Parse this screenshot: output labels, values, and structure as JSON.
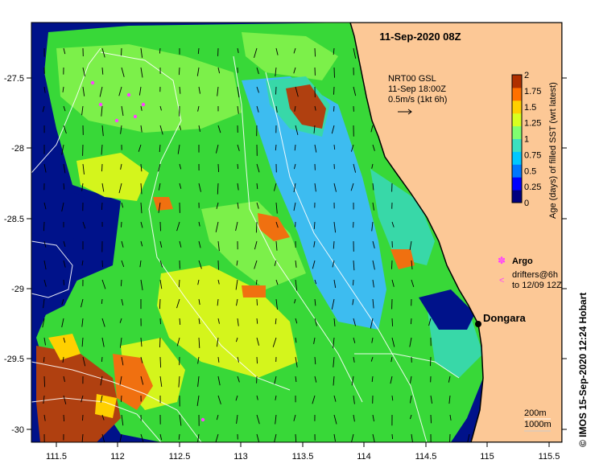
{
  "title": "11-Sep-2020 08Z",
  "product": {
    "line1": "NRT00 GSL",
    "line2": "11-Sep 18:00Z",
    "line3": "0.5m/s (1kt 6h)"
  },
  "colorbar": {
    "label": "Age (days) of filled SST (wrt latest)",
    "ticks": [
      "0",
      "0.25",
      "0.5",
      "0.75",
      "1",
      "1.25",
      "1.5",
      "1.75",
      "2"
    ],
    "colors": [
      "#00007f",
      "#0000ff",
      "#0077ff",
      "#00c8ff",
      "#3ce0c0",
      "#80ff70",
      "#d8ff20",
      "#ffd000",
      "#ff7000",
      "#b03000"
    ]
  },
  "legend": {
    "argo": "Argo",
    "drifters_line1": "drifters@6h",
    "drifters_line2": "to 12/09 12Z",
    "argo_color": "#ff40ff",
    "drifter_color": "#ff40ff"
  },
  "place": {
    "name": "Dongara"
  },
  "isobaths": {
    "a": "200m",
    "b": "1000m"
  },
  "credit": "© IMOS 15-Sep-2020 12:24 Hobart",
  "axes": {
    "x_ticks": [
      "111.5",
      "112",
      "112.5",
      "113",
      "113.5",
      "114",
      "114.5",
      "115",
      "115.5"
    ],
    "y_ticks": [
      "-27.5",
      "-28",
      "-28.5",
      "-29",
      "-29.5",
      "-30"
    ]
  },
  "colors": {
    "land": "#fcc896",
    "deep_ocean": "#00128a",
    "coast": "#000000"
  }
}
